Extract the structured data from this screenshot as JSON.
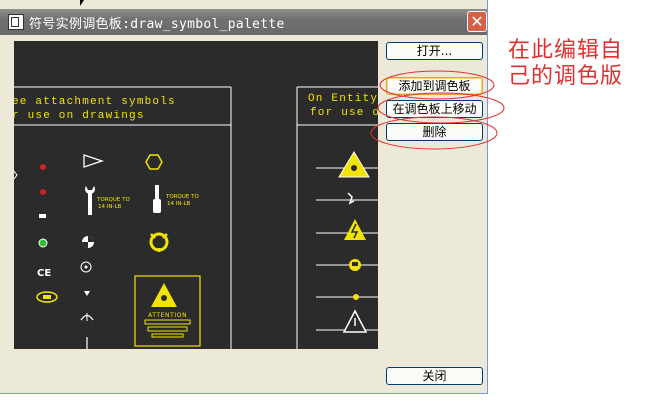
{
  "window": {
    "title": "符号实例调色板:draw_symbol_palette",
    "close_glyph": "✕"
  },
  "buttons": {
    "open": "打开...",
    "add_to_palette": "添加到调色板",
    "move_on_palette": "在调色板上移动",
    "delete": "删除",
    "close": "关闭"
  },
  "palette": {
    "left_header_line1": "ee attachment symbols",
    "left_header_line2": "r use on drawings",
    "right_header_line1": "On Entity",
    "right_header_line2": "for use o",
    "torque_label_1a": "TORQUE TO",
    "torque_label_1b": "14 IN-LB",
    "torque_label_2a": "TORQUE TO",
    "torque_label_2b": "14 IN-LB",
    "ce_mark": "CE",
    "attention_label": "ATTENTION"
  },
  "annotation": {
    "line1": "在此编辑自",
    "line2": "己的调色版",
    "color": "#e23030"
  },
  "colors": {
    "canvas_bg": "#2b2b2b",
    "symbol_yellow": "#f2e400",
    "symbol_white": "#ffffff",
    "symbol_red": "#d02020",
    "symbol_green": "#30c030"
  }
}
